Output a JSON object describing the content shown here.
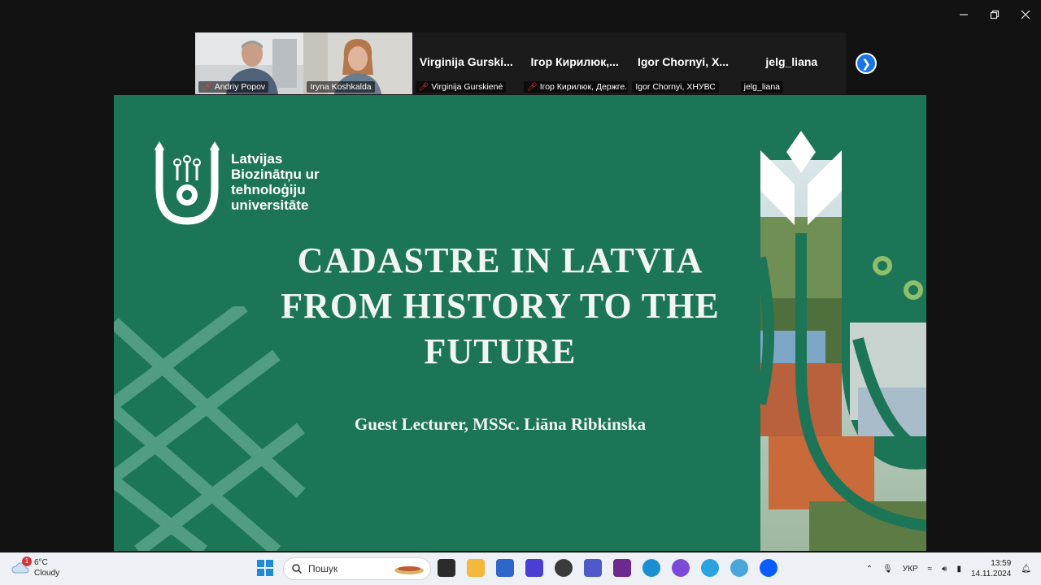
{
  "participants": [
    {
      "name": "Andriy Popov",
      "muted": true,
      "video": true
    },
    {
      "name": "Iryna Koshkalda",
      "muted": false,
      "video": true,
      "active": true
    },
    {
      "display": "Virginija Gurski...",
      "name": "Virginija Gurskienė",
      "muted": true
    },
    {
      "display": "Ігор Кирилюк,...",
      "name": "Ігор Кирилюк, Держге...",
      "muted": true
    },
    {
      "display": "Igor Chornyi, Х...",
      "name": "Igor Chornyi, ХНУВС",
      "muted": false
    },
    {
      "display": "jelg_liana",
      "name": "jelg_liana",
      "muted": false
    }
  ],
  "slide": {
    "logo_lines": [
      "Latvijas",
      "Biozinātņu ur",
      "tehnoloģiju",
      "universitāte"
    ],
    "title_lines": [
      "CADASTRE IN LATVIA",
      "FROM HISTORY TO THE",
      "FUTURE"
    ],
    "subtitle": "Guest Lecturer,  MSSc. Liāna Ribkinska",
    "colors": {
      "background": "#1d7558",
      "text": "#f2f6f2"
    }
  },
  "taskbar": {
    "weather_temp": "6°C",
    "weather_desc": "Cloudy",
    "weather_badge": "1",
    "search_placeholder": "Пошук",
    "language": "УКР",
    "time": "13:59",
    "date": "14.11.2024"
  }
}
